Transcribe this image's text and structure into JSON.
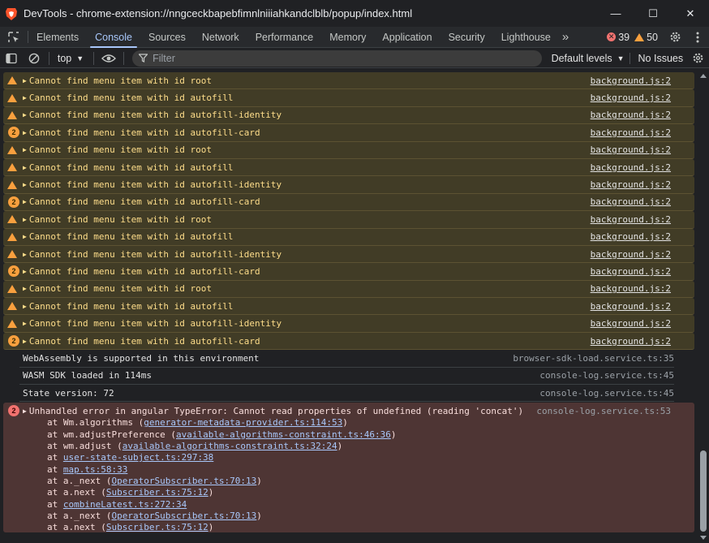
{
  "window": {
    "title": "DevTools - chrome-extension://nngceckbapebfimnlniiiahkandclblb/popup/index.html",
    "minimize_glyph": "—",
    "maximize_glyph": "☐",
    "close_glyph": "✕"
  },
  "tabs": [
    {
      "label": "Elements"
    },
    {
      "label": "Console"
    },
    {
      "label": "Sources"
    },
    {
      "label": "Network"
    },
    {
      "label": "Performance"
    },
    {
      "label": "Memory"
    },
    {
      "label": "Application"
    },
    {
      "label": "Security"
    },
    {
      "label": "Lighthouse"
    }
  ],
  "more_tabs_glyph": "»",
  "counts": {
    "errors": "39",
    "warnings": "50"
  },
  "toolbar": {
    "context": "top",
    "filter_placeholder": "Filter",
    "levels": "Default levels",
    "issues": "No Issues"
  },
  "messages": [
    {
      "kind": "warn",
      "text": "Cannot find menu item with id root",
      "src": "background.js:2"
    },
    {
      "kind": "warn",
      "text": "Cannot find menu item with id autofill",
      "src": "background.js:2"
    },
    {
      "kind": "warn",
      "text": "Cannot find menu item with id autofill-identity",
      "src": "background.js:2"
    },
    {
      "kind": "warn",
      "repeat": "2",
      "text": "Cannot find menu item with id autofill-card",
      "src": "background.js:2"
    },
    {
      "kind": "warn",
      "text": "Cannot find menu item with id root",
      "src": "background.js:2"
    },
    {
      "kind": "warn",
      "text": "Cannot find menu item with id autofill",
      "src": "background.js:2"
    },
    {
      "kind": "warn",
      "text": "Cannot find menu item with id autofill-identity",
      "src": "background.js:2"
    },
    {
      "kind": "warn",
      "repeat": "2",
      "text": "Cannot find menu item with id autofill-card",
      "src": "background.js:2"
    },
    {
      "kind": "warn",
      "text": "Cannot find menu item with id root",
      "src": "background.js:2"
    },
    {
      "kind": "warn",
      "text": "Cannot find menu item with id autofill",
      "src": "background.js:2"
    },
    {
      "kind": "warn",
      "text": "Cannot find menu item with id autofill-identity",
      "src": "background.js:2"
    },
    {
      "kind": "warn",
      "repeat": "2",
      "text": "Cannot find menu item with id autofill-card",
      "src": "background.js:2"
    },
    {
      "kind": "warn",
      "text": "Cannot find menu item with id root",
      "src": "background.js:2"
    },
    {
      "kind": "warn",
      "text": "Cannot find menu item with id autofill",
      "src": "background.js:2"
    },
    {
      "kind": "warn",
      "text": "Cannot find menu item with id autofill-identity",
      "src": "background.js:2"
    },
    {
      "kind": "warn",
      "repeat": "2",
      "text": "Cannot find menu item with id autofill-card",
      "src": "background.js:2"
    },
    {
      "kind": "info",
      "text": "WebAssembly is supported in this environment",
      "src": "browser-sdk-load.service.ts:35"
    },
    {
      "kind": "info",
      "text": "WASM SDK loaded in 114ms",
      "src": "console-log.service.ts:45"
    },
    {
      "kind": "info",
      "text": "State version: 72",
      "src": "console-log.service.ts:45"
    }
  ],
  "error": {
    "repeat": "2",
    "text": "Unhandled error in angular TypeError: Cannot read properties of undefined (reading 'concat')",
    "src": "console-log.service.ts:53",
    "stack": [
      {
        "pre": "at Wm.algorithms (",
        "link": "generator-metadata-provider.ts:114:53",
        "post": ")"
      },
      {
        "pre": "at wm.adjustPreference (",
        "link": "available-algorithms-constraint.ts:46:36",
        "post": ")"
      },
      {
        "pre": "at wm.adjust (",
        "link": "available-algorithms-constraint.ts:32:24",
        "post": ")"
      },
      {
        "pre": "at ",
        "link": "user-state-subject.ts:297:38",
        "post": ""
      },
      {
        "pre": "at ",
        "link": "map.ts:58:33",
        "post": ""
      },
      {
        "pre": "at a._next (",
        "link": "OperatorSubscriber.ts:70:13",
        "post": ")"
      },
      {
        "pre": "at a.next (",
        "link": "Subscriber.ts:75:12",
        "post": ")"
      },
      {
        "pre": "at ",
        "link": "combineLatest.ts:272:34",
        "post": ""
      },
      {
        "pre": "at a._next (",
        "link": "OperatorSubscriber.ts:70:13",
        "post": ")"
      },
      {
        "pre": "at a.next (",
        "link": "Subscriber.ts:75:12",
        "post": ")"
      }
    ]
  }
}
